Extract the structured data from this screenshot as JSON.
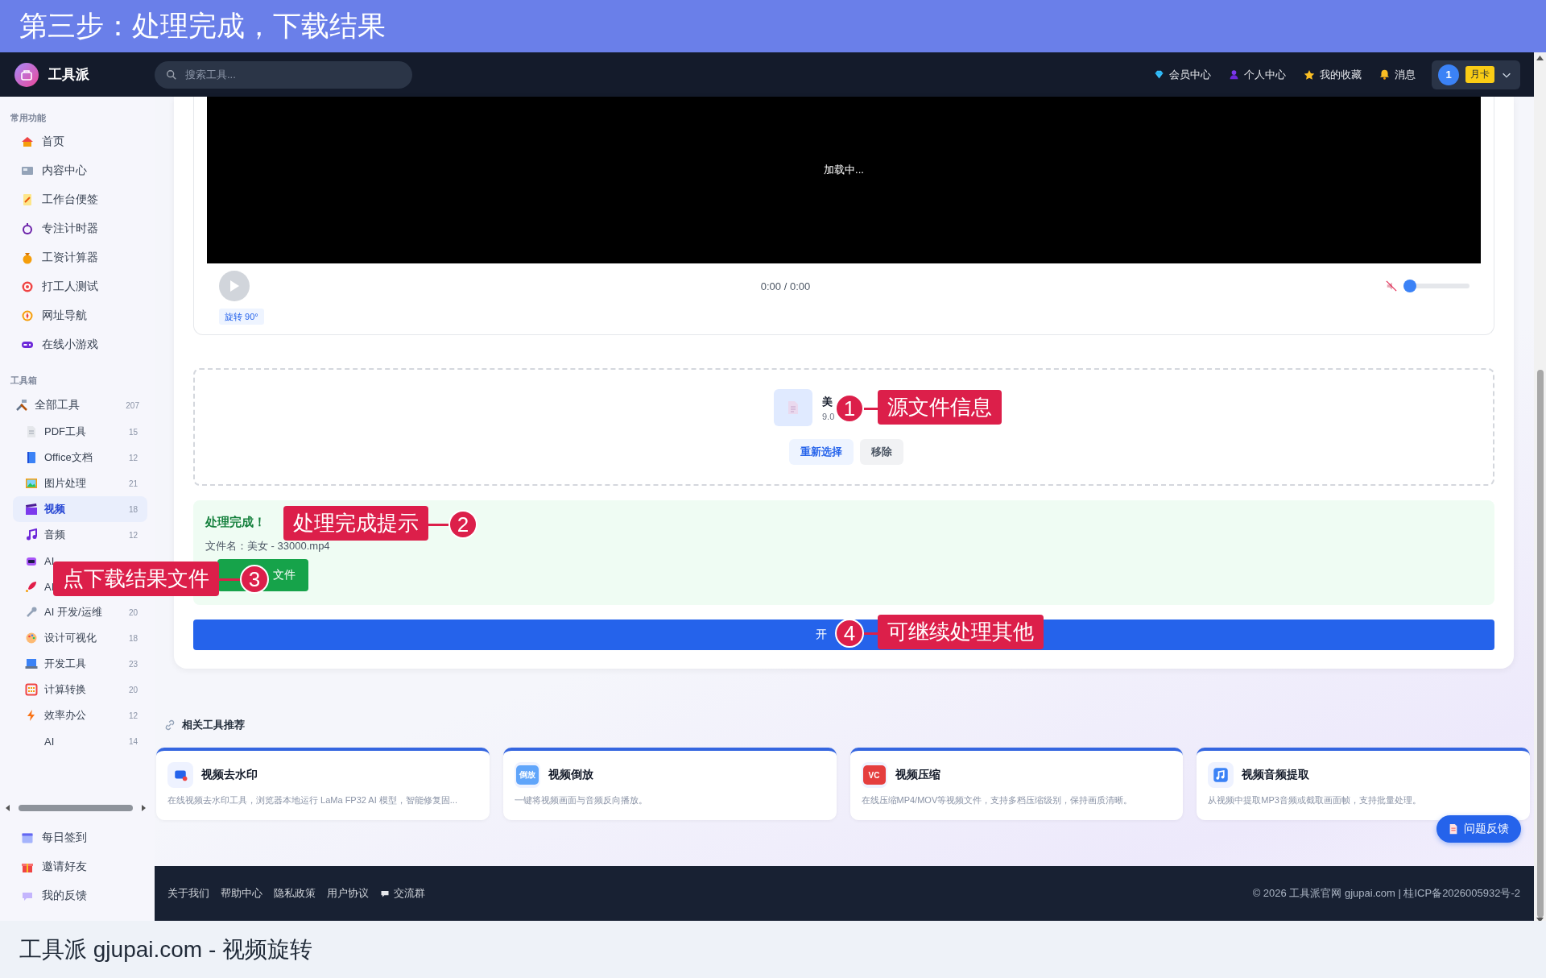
{
  "banner": {
    "title": "第三步：处理完成，下载结果"
  },
  "header": {
    "app_name": "工具派",
    "search": {
      "placeholder": "搜索工具..."
    },
    "nav": [
      {
        "label": "会员中心"
      },
      {
        "label": "个人中心"
      },
      {
        "label": "我的收藏"
      },
      {
        "label": "消息"
      }
    ],
    "user": {
      "avatar": "1",
      "badge": "月卡"
    }
  },
  "sidebar": {
    "sections": [
      {
        "heading": "常用功能",
        "items": [
          {
            "label": "首页",
            "selected": false
          },
          {
            "label": "内容中心",
            "selected": false
          },
          {
            "label": "工作台便签",
            "selected": false
          },
          {
            "label": "专注计时器",
            "selected": false
          },
          {
            "label": "工资计算器",
            "selected": false
          },
          {
            "label": "打工人测试",
            "selected": false
          },
          {
            "label": "网址导航",
            "selected": false
          },
          {
            "label": "在线小游戏",
            "selected": false
          }
        ]
      },
      {
        "heading": "工具箱",
        "items": [
          {
            "label": "全部工具",
            "count": "207",
            "selected": false,
            "children": [
              {
                "label": "PDF工具",
                "count": "15",
                "selected": false
              },
              {
                "label": "Office文档",
                "count": "12",
                "selected": false
              },
              {
                "label": "图片处理",
                "count": "21",
                "selected": false
              },
              {
                "label": "视频",
                "count": "18",
                "selected": true
              },
              {
                "label": "音频",
                "count": "12",
                "selected": false
              },
              {
                "label": "AI",
                "selected": false
              },
              {
                "label": "AI",
                "selected": false
              },
              {
                "label": "AI 开发/运维",
                "count": "20",
                "selected": false
              },
              {
                "label": "设计可视化",
                "count": "18",
                "selected": false
              },
              {
                "label": "开发工具",
                "count": "23",
                "selected": false
              },
              {
                "label": "计算转换",
                "count": "20",
                "selected": false
              },
              {
                "label": "效率办公",
                "count": "12",
                "selected": false
              },
              {
                "label": "AI",
                "count": "14",
                "selected": false
              }
            ]
          }
        ]
      }
    ],
    "bottom_items": [
      {
        "label": "每日签到"
      },
      {
        "label": "邀请好友"
      },
      {
        "label": "我的反馈"
      }
    ]
  },
  "player": {
    "status": "加载中...",
    "time": "0:00 / 0:00",
    "muted": true,
    "volume": {
      "level": 0
    },
    "rotate_tag": "旋转 90°"
  },
  "source_file": {
    "name": "美",
    "size": "9.0",
    "buttons": [
      "重新选择",
      "移除"
    ]
  },
  "result": {
    "title": "处理完成！",
    "filename": "文件名：美女 - 33000.mp4",
    "download_button": "文件"
  },
  "start_button": "开",
  "related": {
    "heading": "相关工具推荐",
    "tools": [
      {
        "title": "视频去水印",
        "description": "在线视频去水印工具，浏览器本地运行 LaMa FP32 AI 模型，智能修复固..."
      },
      {
        "title": "视频倒放",
        "icon_text": "倒放",
        "description": "一键将视频画面与音频反向播放。"
      },
      {
        "title": "视频压缩",
        "icon_text": "VC",
        "description": "在线压缩MP4/MOV等视频文件，支持多档压缩级别，保持画质清晰。"
      },
      {
        "title": "视频音频提取",
        "description": "从视频中提取MP3音频或截取画面帧，支持批量处理。"
      }
    ]
  },
  "feedback_button": "问题反馈",
  "footer": {
    "links": [
      "关于我们",
      "帮助中心",
      "隐私政策",
      "用户协议"
    ],
    "community": "交流群",
    "copyright": "© 2026 工具派官网 gjupai.com | 桂ICP备2026005932号-2"
  },
  "annotations": [
    {
      "number": "1",
      "text": "源文件信息"
    },
    {
      "number": "2",
      "text": "处理完成提示"
    },
    {
      "number": "3",
      "text": "点下载结果文件"
    },
    {
      "number": "4",
      "text": "可继续处理其他"
    }
  ],
  "caption": "工具派 gjupai.com - 视频旋转"
}
